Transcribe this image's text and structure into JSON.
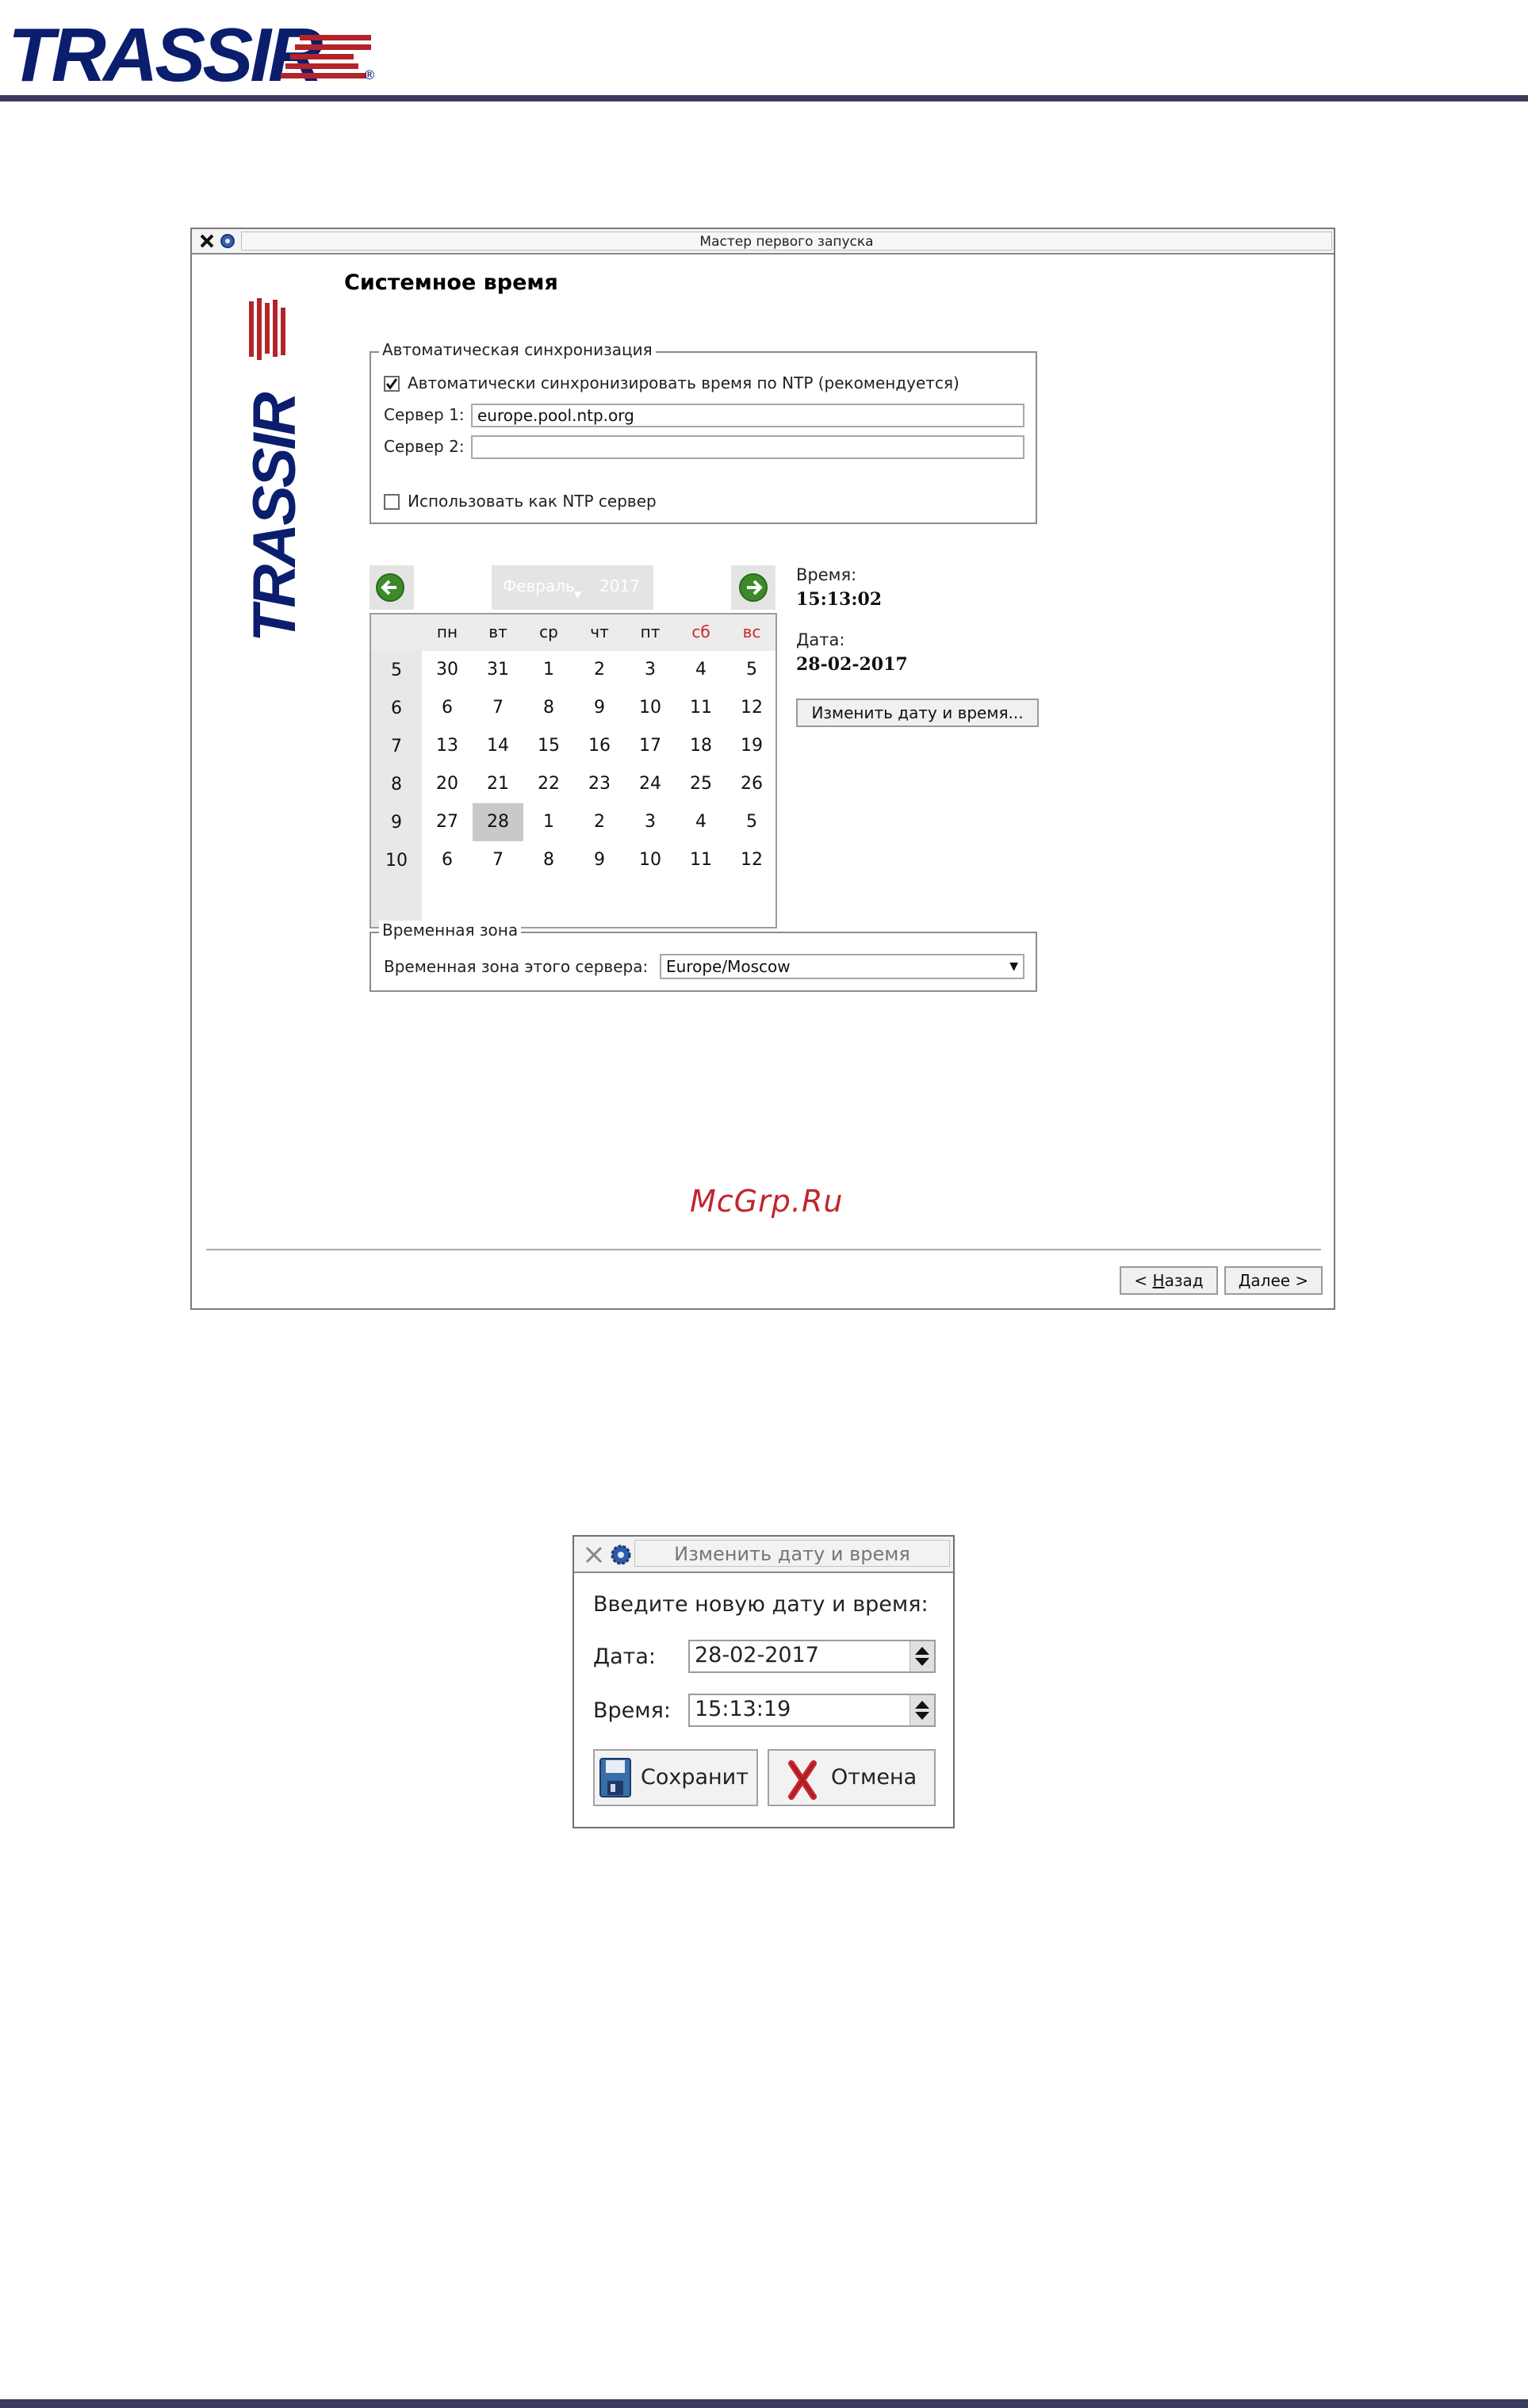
{
  "brand": {
    "logo_text": "TRASSIR",
    "registered": "®",
    "logo_blue": "#0b1e6e",
    "logo_red": "#b3232a"
  },
  "wizard": {
    "title": "Мастер первого запуска",
    "section_title": "Системное время",
    "ntp_group": {
      "legend": "Автоматическая синхронизация",
      "auto_sync_label": "Автоматически синхронизировать время по NTP (рекомендуется)",
      "auto_sync_checked": true,
      "server1_label": "Сервер 1:",
      "server1_value": "europe.pool.ntp.org",
      "server2_label": "Сервер 2:",
      "server2_value": "",
      "use_as_ntp_label": "Использовать как NTP сервер",
      "use_as_ntp_checked": false
    },
    "calendar": {
      "month": "Февраль",
      "year": "2017",
      "weekdays": [
        "пн",
        "вт",
        "ср",
        "чт",
        "пт",
        "сб",
        "вс"
      ],
      "rows": [
        {
          "week": "5",
          "days": [
            "30",
            "31",
            "1",
            "2",
            "3",
            "4",
            "5"
          ]
        },
        {
          "week": "6",
          "days": [
            "6",
            "7",
            "8",
            "9",
            "10",
            "11",
            "12"
          ]
        },
        {
          "week": "7",
          "days": [
            "13",
            "14",
            "15",
            "16",
            "17",
            "18",
            "19"
          ]
        },
        {
          "week": "8",
          "days": [
            "20",
            "21",
            "22",
            "23",
            "24",
            "25",
            "26"
          ]
        },
        {
          "week": "9",
          "days": [
            "27",
            "28",
            "1",
            "2",
            "3",
            "4",
            "5"
          ]
        },
        {
          "week": "10",
          "days": [
            "6",
            "7",
            "8",
            "9",
            "10",
            "11",
            "12"
          ]
        }
      ],
      "weekend_red_rows": [
        0,
        1,
        2,
        3
      ],
      "selected": {
        "row": 4,
        "col": 1
      }
    },
    "time_label": "Время:",
    "time_value": "15:13:02",
    "date_label": "Дата:",
    "date_value": "28-02-2017",
    "change_button": "Изменить дату и время...",
    "tz_group": {
      "legend": "Временная зона",
      "label": "Временная зона этого сервера:",
      "value": "Europe/Moscow"
    },
    "watermark": "McGrp.Ru",
    "back_prefix": "< ",
    "back_accel": "Н",
    "back_rest": "азад",
    "next_accel": "Д",
    "next_rest": "алее >"
  },
  "dialog": {
    "title": "Изменить дату и время",
    "prompt": "Введите новую дату и время:",
    "date_label": "Дата:",
    "date_value": "28-02-2017",
    "time_label": "Время:",
    "time_value": "15:13:19",
    "save_button": "Сохранит",
    "cancel_button": "Отмена"
  },
  "colors": {
    "weekend": "#d0262d",
    "rule": "#3a3a5c",
    "nav_green": "#3c8a2a"
  }
}
